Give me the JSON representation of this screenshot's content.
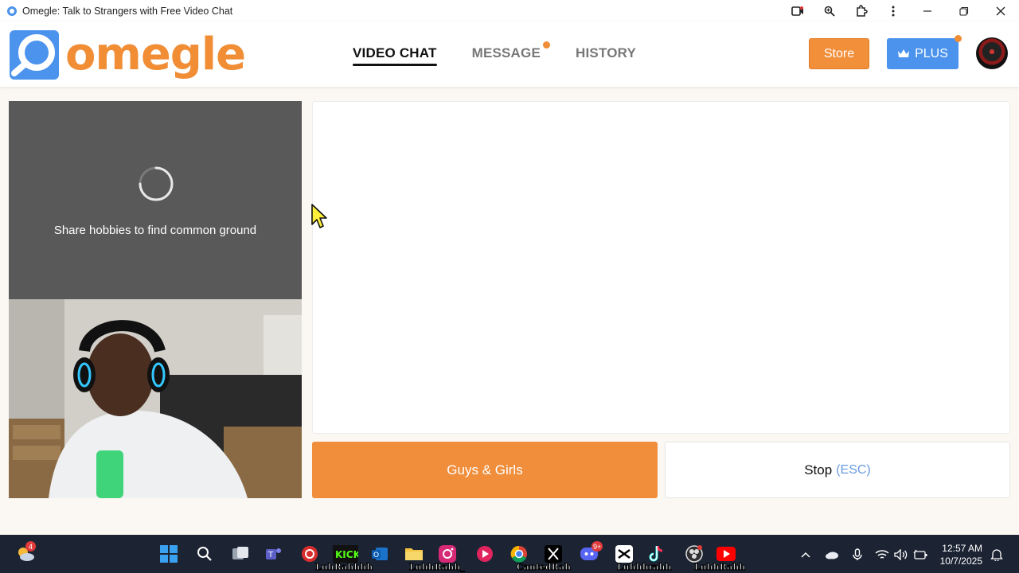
{
  "window": {
    "title": "Omegle: Talk to Strangers with Free Video Chat",
    "icons": [
      "camera-icon",
      "zoom-icon",
      "extension-icon",
      "more-icon",
      "minimize-icon",
      "restore-icon",
      "close-icon"
    ]
  },
  "header": {
    "logo_text": "omegle",
    "nav": [
      {
        "label": "VIDEO CHAT",
        "active": true
      },
      {
        "label": "MESSAGE",
        "notification": true
      },
      {
        "label": "HISTORY"
      }
    ],
    "store_label": "Store",
    "plus_label": "PLUS"
  },
  "stranger": {
    "status": "Share hobbies to find common ground"
  },
  "controls": {
    "match_label": "Guys & Girls",
    "stop_label": "Stop",
    "stop_hint": "(ESC)"
  },
  "colors": {
    "brand_orange": "#f08d35",
    "plus_blue": "#4b93ec",
    "taskbar": "#1c2433"
  },
  "taskbar": {
    "weather_badge": "4",
    "discord_badge": "9+",
    "captions": {
      "kick": "LuhRahhhh",
      "instagram": "LuhhRahh_",
      "x": "CantedRah",
      "tiktok": "Luhhhrahh",
      "youtube": "LuhhRahh"
    },
    "time": "12:57 AM",
    "date": "10/7/2025"
  }
}
